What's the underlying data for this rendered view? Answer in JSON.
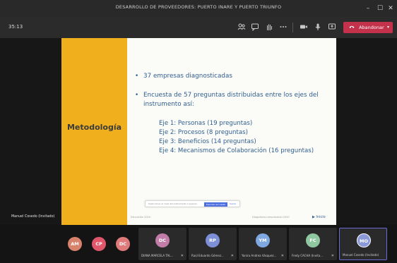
{
  "window": {
    "title": "DESARROLLO DE PROVEEDORES: PUERTO INARE Y PUERTO TRIUNFO",
    "controls": [
      "–",
      "☐",
      "✕"
    ]
  },
  "toolbar": {
    "timer": "35:13",
    "leave_label": "Abandonar",
    "leave_caret": "▾"
  },
  "slide": {
    "section_title": "Metodología",
    "bullet_1": "37 empresas diagnosticadas",
    "bullet_2": "Encuesta de 57 preguntas distribuidas entre los ejes del instrumento así:",
    "ejes": [
      "Eje 1: Personas (19 preguntas)",
      "Eje 2: Procesos (8 preguntas)",
      "Eje 3: Beneficios (14 preguntas)",
      "Eje 4: Mecanismos de Colaboración (16 preguntas)"
    ],
    "prompt_text": "Seleccionar el nivel del instrumento a evaluar",
    "prompt_button": "Ejecutar encuesta",
    "prompt_link": "Cerrar",
    "footer_left": "Educación 2020",
    "footer_mid": "Diagnóstico empresarial 2020",
    "footer_right": "▶ Inicio",
    "presenter": "Manuel Cosedo (Invitado)"
  },
  "participants": [
    {
      "initials": "AM",
      "color": "#d9826b"
    },
    {
      "initials": "CP",
      "color": "#e0566b"
    },
    {
      "initials": "DC",
      "color": "#e07a7a"
    },
    {
      "initials": "DC",
      "color": "#c27ca8",
      "name": "DIANA MARCELA TAL..."
    },
    {
      "initials": "RP",
      "color": "#7d8fd6",
      "name": "Raúl Eduardo Gómez..."
    },
    {
      "initials": "YM",
      "color": "#7fa7e0",
      "name": "Yanira Andrea Vásquez..."
    },
    {
      "initials": "FC",
      "color": "#8ec7a0",
      "name": "Fredy CACHA (Invita..."
    },
    {
      "initials": "MO",
      "color": "#8a9ad8",
      "name": "Manuel Cosedo (Invitado)"
    }
  ]
}
